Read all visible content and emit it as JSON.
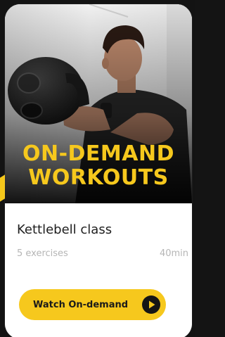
{
  "card": {
    "title_line1": "ON-DEMAND",
    "title_line2": "WORKOUTS",
    "class_name": "Kettlebell class",
    "exercise_count": "5 exercises",
    "duration": "40min",
    "button_label": "Watch On-demand",
    "button_icon": "play-icon"
  },
  "colors": {
    "accent": "#f6c81d",
    "background": "#131313",
    "card": "#ffffff",
    "muted_text": "#b5b5b5"
  }
}
